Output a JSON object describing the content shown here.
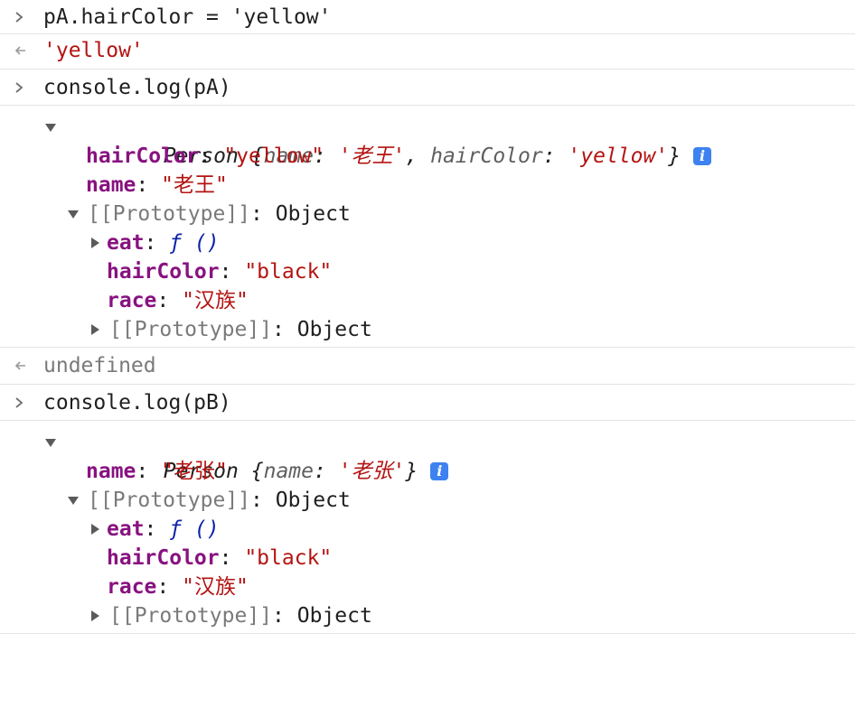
{
  "entries": [
    {
      "type": "input",
      "text": "pA.hairColor = 'yellow'"
    },
    {
      "type": "result",
      "text": "'yellow'"
    },
    {
      "type": "input",
      "text": "console.log(pA)"
    },
    {
      "type": "log_pa",
      "summary": {
        "class": "Person",
        "props": [
          {
            "k": "name",
            "v": "'老王'"
          },
          {
            "k": "hairColor",
            "v": "'yellow'"
          }
        ]
      },
      "own": [
        {
          "k": "hairColor",
          "v": "\"yellow\""
        },
        {
          "k": "name",
          "v": "\"老王\""
        }
      ],
      "proto_label": "[[Prototype]]",
      "proto_type": "Object",
      "proto": {
        "eat_key": "eat",
        "eat_val": "ƒ ()",
        "hairColor": "\"black\"",
        "race": "\"汉族\"",
        "inner_label": "[[Prototype]]",
        "inner_type": "Object"
      }
    },
    {
      "type": "result",
      "text": "undefined"
    },
    {
      "type": "input",
      "text": "console.log(pB)"
    },
    {
      "type": "log_pb",
      "summary": {
        "class": "Person",
        "props": [
          {
            "k": "name",
            "v": "'老张'"
          }
        ]
      },
      "own": [
        {
          "k": "name",
          "v": "\"老张\""
        }
      ],
      "proto_label": "[[Prototype]]",
      "proto_type": "Object",
      "proto": {
        "eat_key": "eat",
        "eat_val": "ƒ ()",
        "hairColor": "\"black\"",
        "race": "\"汉族\"",
        "inner_label": "[[Prototype]]",
        "inner_type": "Object"
      }
    }
  ],
  "labels": {
    "hairColor": "hairColor",
    "race": "race",
    "name": "name",
    "info": "i"
  },
  "colors": {
    "string": "#b31412",
    "key": "#881280",
    "function": "#0d22aa",
    "info_badge": "#3d82f0",
    "divider": "#e4e4e4"
  }
}
